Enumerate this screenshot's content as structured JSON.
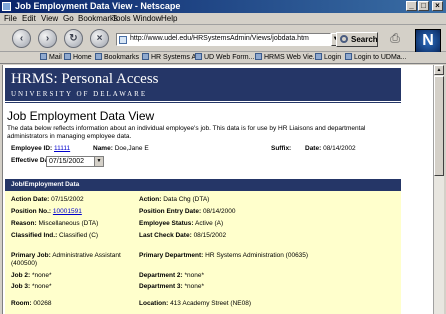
{
  "window": {
    "title": "Job Employment Data View - Netscape"
  },
  "menu": [
    "File",
    "Edit",
    "View",
    "Go",
    "Bookmarks",
    "Tools",
    "Window",
    "Help"
  ],
  "nav": {
    "url": "http://www.udel.edu/HRSystemsAdmin/Views/jobdata.htm",
    "search_label": "Search"
  },
  "bookmarks": [
    "Mail",
    "Home",
    "Bookmarks",
    "HR Systems A...",
    "UD Web Form...",
    "HRMS Web Vie...",
    "Login",
    "Login to UDMa..."
  ],
  "banner": {
    "title": "HRMS: Personal Access",
    "subtitle": "UNIVERSITY OF DELAWARE"
  },
  "page": {
    "title": "Job Employment Data View",
    "intro": "The data below reflects information about an individual employee's job. This data is for use by HR Liaisons and departmental administrators in managing employee data."
  },
  "header_fields": {
    "employee_id_label": "Employee ID:",
    "employee_id": "11111",
    "name_label": "Name:",
    "name": "Doe,Jane E",
    "suffix_label": "Suffix:",
    "date_label": "Date:",
    "date": "08/14/2002",
    "effective_date_label": "Effective Date:",
    "effective_date": "07/15/2002"
  },
  "section": {
    "title": "Job/Employment Data"
  },
  "job": {
    "action_date_label": "Action Date:",
    "action_date": "07/15/2002",
    "action_label": "Action:",
    "action": "Data Chg (DTA)",
    "position_no_label": "Position No.:",
    "position_no": "10001591",
    "position_entry_label": "Position Entry Date:",
    "position_entry": "08/14/2000",
    "reason_label": "Reason:",
    "reason": "Miscellaneous (DTA)",
    "emp_status_label": "Employee Status:",
    "emp_status": "Active (A)",
    "classified_label": "Classified Ind.:",
    "classified": "Classified (C)",
    "last_check_label": "Last Check Date:",
    "last_check": "08/15/2002",
    "primary_job_label": "Primary Job:",
    "primary_job": "Administrative Assistant",
    "primary_job_code": "(400500)",
    "primary_dept_label": "Primary Department:",
    "primary_dept": "HR Systems Administration (00635)",
    "job2_label": "Job 2:",
    "job2": "*none*",
    "dept2_label": "Department 2:",
    "dept2": "*none*",
    "job3_label": "Job 3:",
    "job3": "*none*",
    "dept3_label": "Department 3:",
    "dept3": "*none*",
    "room_label": "Room:",
    "room": "00268",
    "location_label": "Location:",
    "location": "413 Academy Street (NE08)"
  }
}
